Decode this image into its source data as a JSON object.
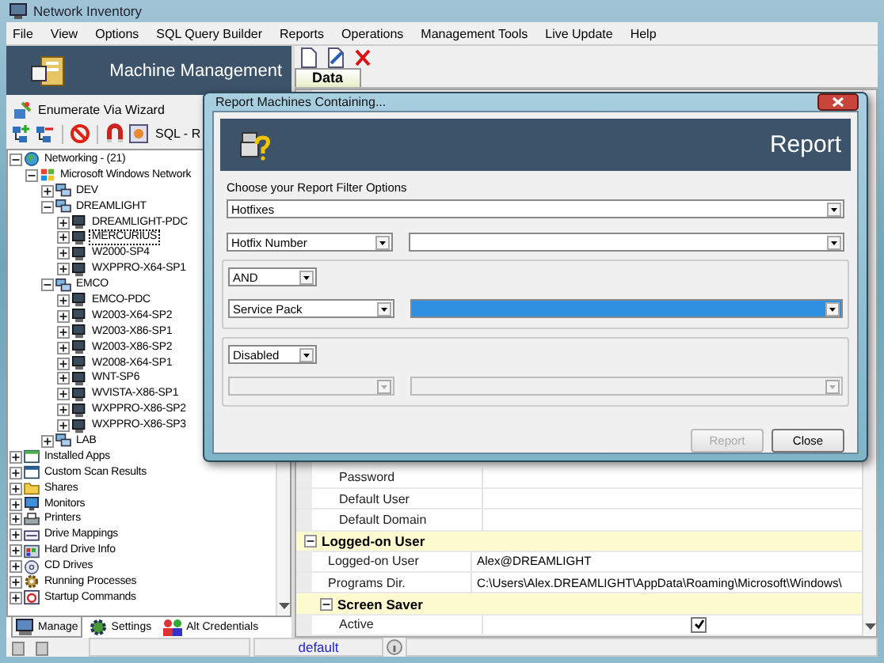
{
  "window": {
    "title": "Network Inventory"
  },
  "menu": [
    "File",
    "View",
    "Options",
    "SQL Query Builder",
    "Reports",
    "Operations",
    "Management Tools",
    "Live Update",
    "Help"
  ],
  "left_panel": {
    "banner_title": "Machine Management",
    "wizard_label": "Enumerate Via Wizard",
    "toolbar_text": "SQL - R",
    "tree": [
      {
        "label": "Networking - (21)",
        "kind": "network",
        "expanded": true,
        "selected": false,
        "children": [
          {
            "label": "Microsoft Windows Network",
            "kind": "windows",
            "expanded": true,
            "selected": false,
            "children": [
              {
                "label": "DEV",
                "kind": "domain",
                "expanded": false,
                "selected": false
              },
              {
                "label": "DREAMLIGHT",
                "kind": "domain",
                "expanded": true,
                "selected": false,
                "children": [
                  {
                    "label": "DREAMLIGHT-PDC",
                    "kind": "computer",
                    "expanded": false,
                    "selected": false
                  },
                  {
                    "label": "MERCURIUS",
                    "kind": "computer",
                    "expanded": false,
                    "selected": true
                  },
                  {
                    "label": "W2000-SP4",
                    "kind": "computer",
                    "expanded": false,
                    "selected": false
                  },
                  {
                    "label": "WXPPRO-X64-SP1",
                    "kind": "computer",
                    "expanded": false,
                    "selected": false
                  }
                ]
              },
              {
                "label": "EMCO",
                "kind": "domain",
                "expanded": true,
                "selected": false,
                "children": [
                  {
                    "label": "EMCO-PDC",
                    "kind": "computer",
                    "expanded": false,
                    "selected": false
                  },
                  {
                    "label": "W2003-X64-SP2",
                    "kind": "computer",
                    "expanded": false,
                    "selected": false
                  },
                  {
                    "label": "W2003-X86-SP1",
                    "kind": "computer",
                    "expanded": false,
                    "selected": false
                  },
                  {
                    "label": "W2003-X86-SP2",
                    "kind": "computer",
                    "expanded": false,
                    "selected": false
                  },
                  {
                    "label": "W2008-X64-SP1",
                    "kind": "computer",
                    "expanded": false,
                    "selected": false
                  },
                  {
                    "label": "WNT-SP6",
                    "kind": "computer",
                    "expanded": false,
                    "selected": false
                  },
                  {
                    "label": "WVISTA-X86-SP1",
                    "kind": "computer",
                    "expanded": false,
                    "selected": false
                  },
                  {
                    "label": "WXPPRO-X86-SP2",
                    "kind": "computer",
                    "expanded": false,
                    "selected": false
                  },
                  {
                    "label": "WXPPRO-X86-SP3",
                    "kind": "computer",
                    "expanded": false,
                    "selected": false
                  }
                ]
              },
              {
                "label": "LAB",
                "kind": "domain",
                "expanded": false,
                "selected": false
              }
            ]
          }
        ]
      },
      {
        "label": "Installed Apps",
        "kind": "apps",
        "expanded": false,
        "selected": false
      },
      {
        "label": "Custom Scan Results",
        "kind": "scan",
        "expanded": false,
        "selected": false
      },
      {
        "label": "Shares",
        "kind": "shares",
        "expanded": false,
        "selected": false
      },
      {
        "label": "Monitors",
        "kind": "monitor",
        "expanded": false,
        "selected": false
      },
      {
        "label": "Printers",
        "kind": "printer",
        "expanded": false,
        "selected": false
      },
      {
        "label": "Drive Mappings",
        "kind": "drive",
        "expanded": false,
        "selected": false
      },
      {
        "label": "Hard Drive Info",
        "kind": "disk",
        "expanded": false,
        "selected": false
      },
      {
        "label": "CD Drives",
        "kind": "cd",
        "expanded": false,
        "selected": false
      },
      {
        "label": "Running Processes",
        "kind": "process",
        "expanded": false,
        "selected": false
      },
      {
        "label": "Startup Commands",
        "kind": "startup",
        "expanded": false,
        "selected": false
      }
    ],
    "tabs": [
      {
        "label": "Manage",
        "selected": true
      },
      {
        "label": "Settings",
        "selected": false
      },
      {
        "label": "Alt Credentials",
        "selected": false
      }
    ]
  },
  "right_panel": {
    "tab": "Data",
    "property_grid": {
      "rows": [
        {
          "kind": "row",
          "name": "Password"
        },
        {
          "kind": "row",
          "name": "Default User"
        },
        {
          "kind": "row",
          "name": "Default Domain"
        }
      ],
      "sections": [
        {
          "name": "Logged-on User",
          "expanded": true,
          "children": [
            {
              "kind": "row",
              "name": "Logged-on User",
              "value": "Alex@DREAMLIGHT"
            },
            {
              "kind": "row",
              "name": "Programs Dir.",
              "value": "C:\\Users\\Alex.DREAMLIGHT\\AppData\\Roaming\\Microsoft\\Windows\\"
            },
            {
              "kind": "section",
              "name": "Screen Saver",
              "expanded": true,
              "children": [
                {
                  "kind": "check",
                  "name": "Active",
                  "checked": true
                }
              ]
            }
          ]
        }
      ]
    }
  },
  "status_bar": {
    "profile": "default"
  },
  "dialog": {
    "title": "Report Machines Containing...",
    "banner_title": "Report",
    "filter_label": "Choose your Report Filter Options",
    "category": "Hotfixes",
    "field": "Hotfix Number",
    "groups": [
      {
        "operator": "AND",
        "field": "Service Pack",
        "disabled": false,
        "value_selected": true
      },
      {
        "operator": "Disabled",
        "disabled": true,
        "value_selected": false
      }
    ],
    "buttons": [
      {
        "label": "Report",
        "disabled": true
      },
      {
        "label": "Close",
        "disabled": false
      }
    ]
  }
}
